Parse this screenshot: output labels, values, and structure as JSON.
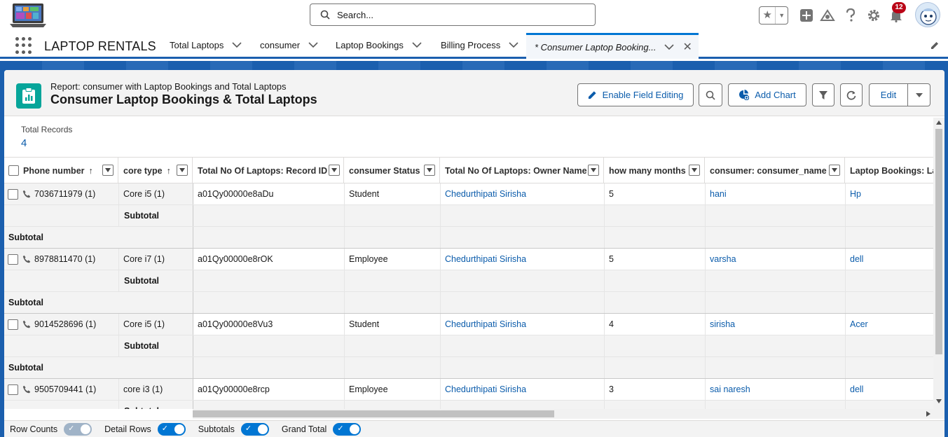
{
  "header": {
    "search_placeholder": "Search...",
    "notification_count": "12"
  },
  "nav": {
    "app_name": "LAPTOP RENTALS",
    "tabs": [
      {
        "label": "Total Laptops"
      },
      {
        "label": "consumer"
      },
      {
        "label": "Laptop Bookings"
      },
      {
        "label": "Billing Process"
      },
      {
        "label": "* Consumer Laptop Booking..."
      }
    ]
  },
  "report": {
    "type_label": "Report: consumer with Laptop Bookings and Total Laptops",
    "title": "Consumer Laptop Bookings & Total Laptops",
    "buttons": {
      "enable_field_editing": "Enable Field Editing",
      "add_chart": "Add Chart",
      "edit": "Edit"
    },
    "total_records_label": "Total Records",
    "total_records_value": "4"
  },
  "table": {
    "columns": [
      "Phone number",
      "core type",
      "Total No Of Laptops: Record ID",
      "consumer Status",
      "Total No Of Laptops: Owner Name",
      "how many months",
      "consumer: consumer_name",
      "Laptop Bookings: La"
    ],
    "subtotal_label": "Subtotal",
    "groups": [
      {
        "phone": "7036711979 (1)",
        "core": "Core i5 (1)",
        "record_id": "a01Qy00000e8aDu",
        "status": "Student",
        "owner": "Chedurthipati Sirisha",
        "months": "5",
        "name": "hani",
        "laptop": "Hp"
      },
      {
        "phone": "8978811470 (1)",
        "core": "Core i7 (1)",
        "record_id": "a01Qy00000e8rOK",
        "status": "Employee",
        "owner": "Chedurthipati Sirisha",
        "months": "5",
        "name": "varsha",
        "laptop": "dell"
      },
      {
        "phone": "9014528696 (1)",
        "core": "Core i5 (1)",
        "record_id": "a01Qy00000e8Vu3",
        "status": "Student",
        "owner": "Chedurthipati Sirisha",
        "months": "4",
        "name": "sirisha",
        "laptop": "Acer"
      },
      {
        "phone": "9505709441 (1)",
        "core": "core i3 (1)",
        "record_id": "a01Qy00000e8rcp",
        "status": "Employee",
        "owner": "Chedurthipati Sirisha",
        "months": "3",
        "name": "sai naresh",
        "laptop": "dell"
      }
    ]
  },
  "footer": {
    "toggles": [
      {
        "label": "Row Counts",
        "on": false
      },
      {
        "label": "Detail Rows",
        "on": true
      },
      {
        "label": "Subtotals",
        "on": true
      },
      {
        "label": "Grand Total",
        "on": true
      }
    ]
  },
  "colors": {
    "brand_blue": "#0176d3",
    "link_blue": "#0b5cab",
    "report_icon": "#06a59a",
    "badge_red": "#ba0517"
  }
}
